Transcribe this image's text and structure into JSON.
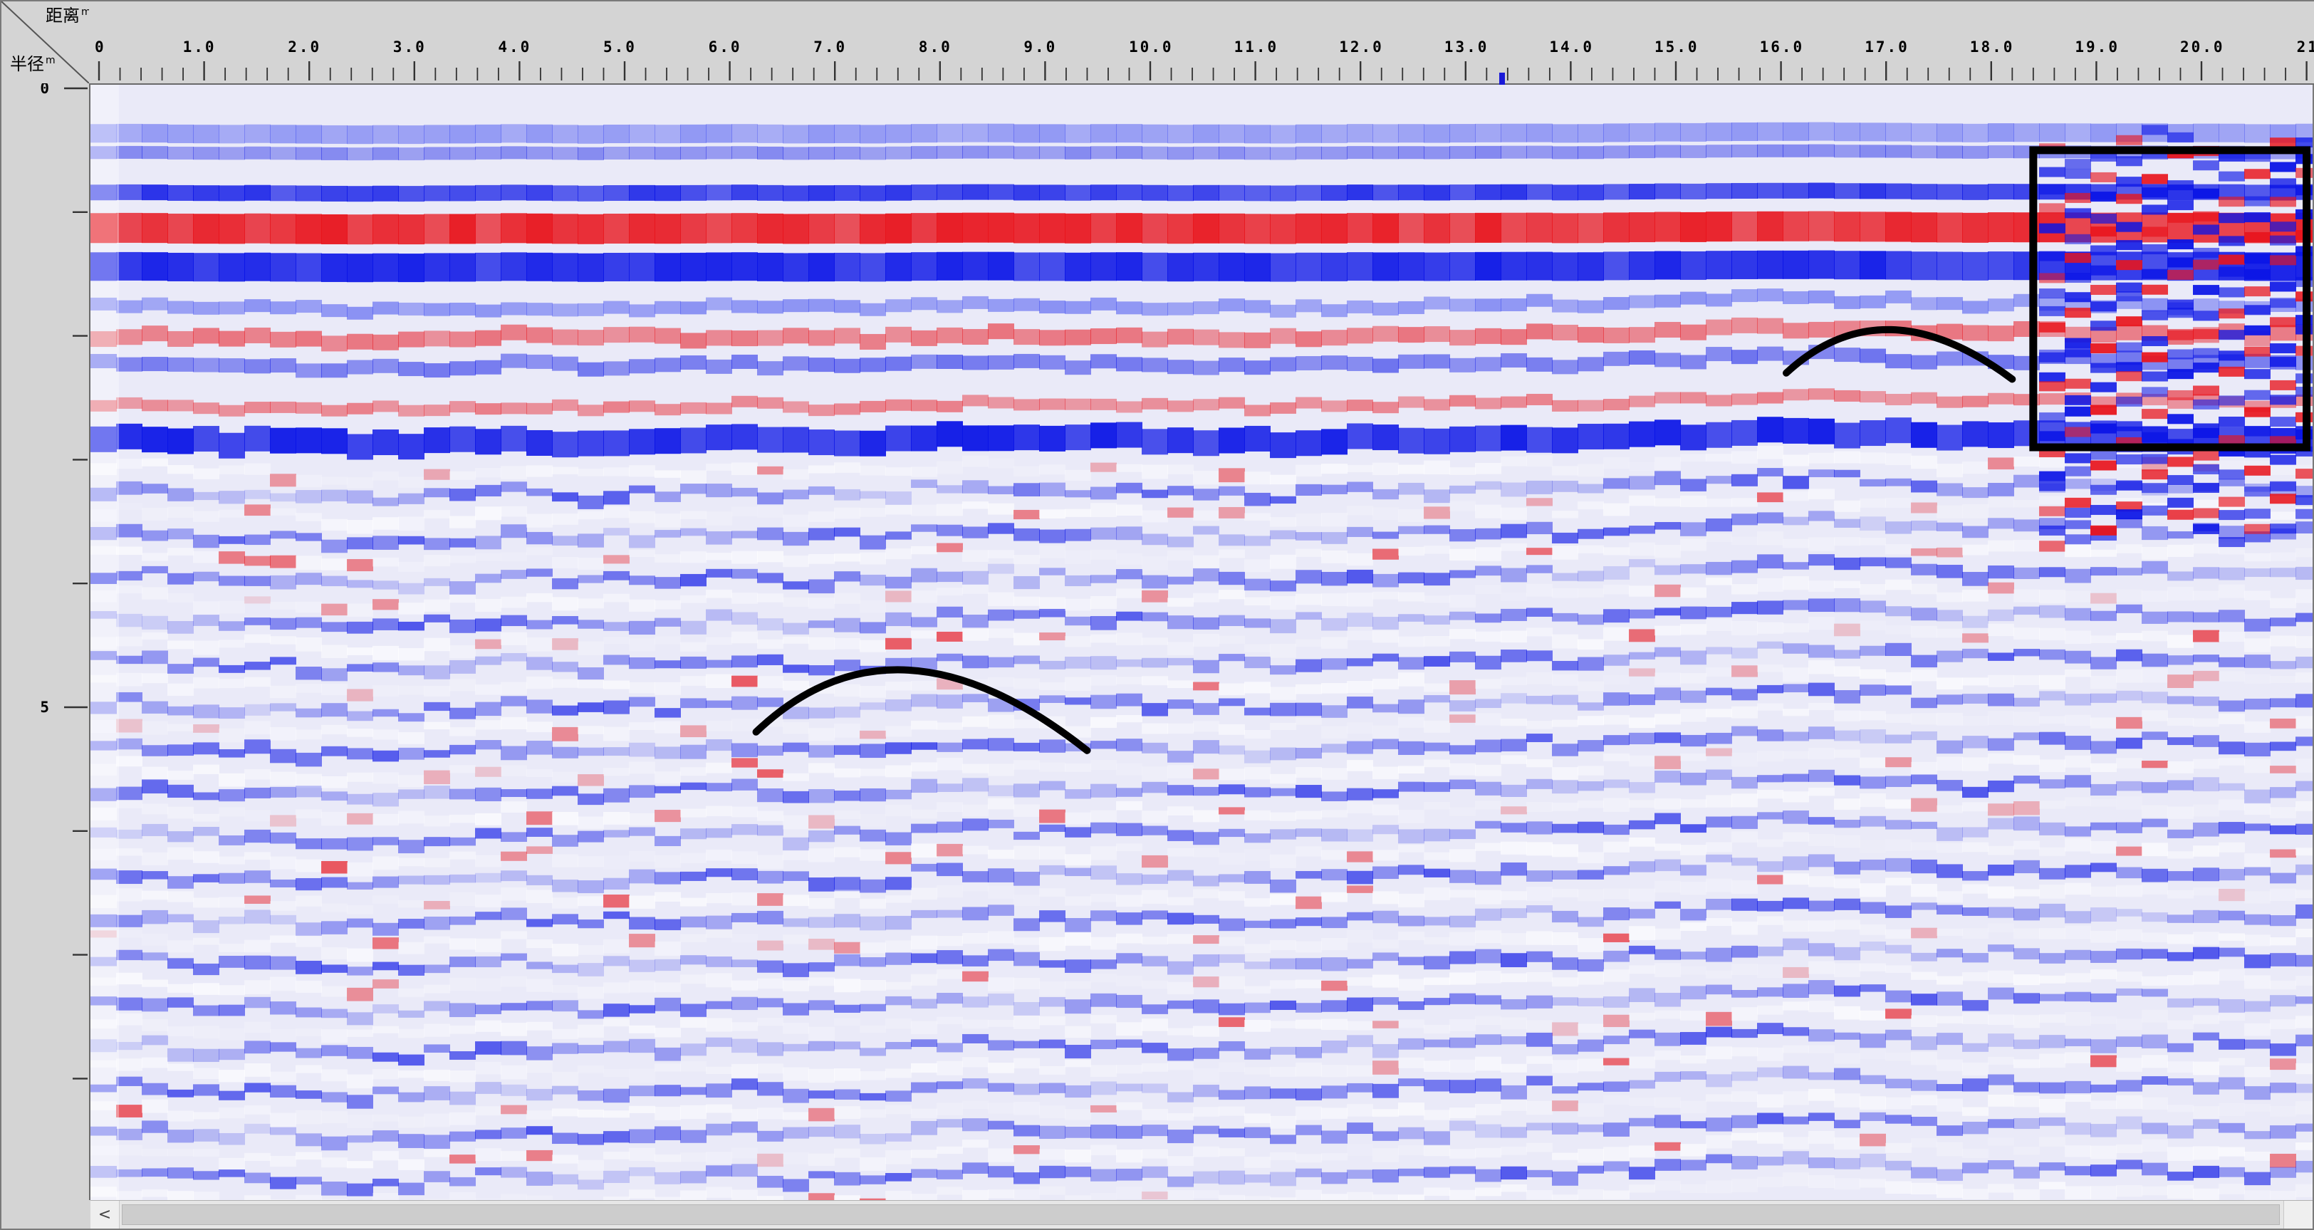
{
  "corner": {
    "x_axis_title": "距离",
    "x_axis_unit": "m",
    "y_axis_title": "半径",
    "y_axis_unit": "m"
  },
  "x_axis": {
    "labels": [
      "0",
      "1.0",
      "2.0",
      "3.0",
      "4.0",
      "5.0",
      "6.0",
      "7.0",
      "8.0",
      "9.0",
      "10.0",
      "11.0",
      "12.0",
      "13.0",
      "14.0",
      "15.0",
      "16.0",
      "17.0",
      "18.0",
      "19.0",
      "20.0",
      "21"
    ],
    "values": [
      0,
      1,
      2,
      3,
      4,
      5,
      6,
      7,
      8,
      9,
      10,
      11,
      12,
      13,
      14,
      15,
      16,
      17,
      18,
      19,
      20,
      21
    ],
    "range": [
      0,
      21
    ],
    "minor_per_major": 5
  },
  "y_axis": {
    "labels": [
      "0",
      "5"
    ],
    "values": [
      0,
      5
    ],
    "range": [
      0,
      9
    ],
    "minor_step": 1
  },
  "cursor": {
    "x_value": 13.35
  },
  "annotations": {
    "arcs": [
      {
        "name": "hyperbola-upper-right",
        "x": [
          16.05,
          17.05,
          18.2
        ],
        "y": [
          2.3,
          1.95,
          2.35
        ]
      },
      {
        "name": "hyperbola-lower-middle",
        "x": [
          6.25,
          7.7,
          9.4
        ],
        "y": [
          5.2,
          4.7,
          5.35
        ]
      }
    ],
    "box": {
      "name": "anomaly-box",
      "x": [
        18.4,
        21.0
      ],
      "y": [
        0.5,
        2.9
      ]
    }
  },
  "colors": {
    "positive": "#e8141c",
    "negative": "#0a14e6",
    "background": "#eaeaf8",
    "annotation": "#000000"
  },
  "scrollbar": {
    "left_arrow": "<"
  }
}
